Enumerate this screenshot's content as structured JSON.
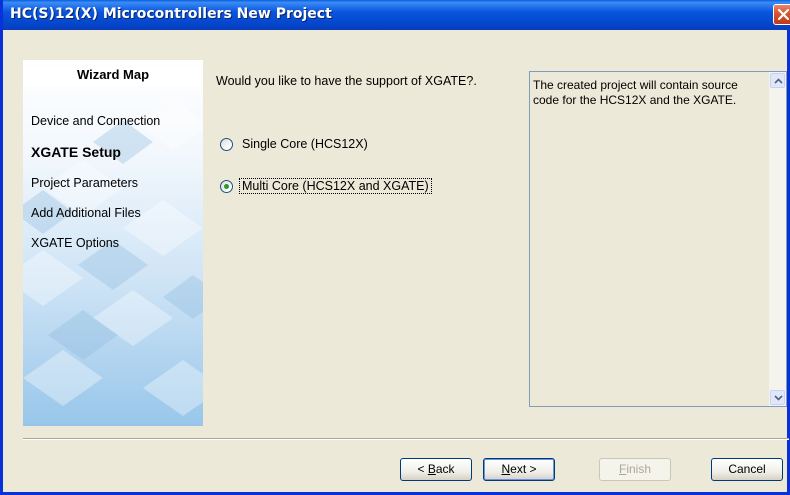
{
  "window": {
    "title": "HC(S)12(X) Microcontrollers New Project"
  },
  "wizard_map": {
    "title": "Wizard Map",
    "steps": [
      {
        "label": "Device and Connection",
        "active": false
      },
      {
        "label": "XGATE Setup",
        "active": true
      },
      {
        "label": "Project Parameters",
        "active": false
      },
      {
        "label": "Add Additional Files",
        "active": false
      },
      {
        "label": "XGATE Options",
        "active": false
      }
    ]
  },
  "main": {
    "question": "Would you like to have the support of XGATE?.",
    "options": [
      {
        "label": "Single Core (HCS12X)",
        "selected": false
      },
      {
        "label": "Multi Core (HCS12X and XGATE)",
        "selected": true
      }
    ],
    "description": "The created project will contain source code for the HCS12X and the XGATE."
  },
  "buttons": {
    "back_prefix": "< ",
    "back_mnemonic": "B",
    "back_rest": "ack",
    "next_mnemonic": "N",
    "next_rest": "ext >",
    "finish_mnemonic": "F",
    "finish_rest": "inish",
    "cancel": "Cancel"
  },
  "colors": {
    "title_bar": "#0855dd",
    "dialog_bg": "#ece9d8",
    "close_button": "#d9532f",
    "radio_checked": "#2a9a2a"
  },
  "icons": {
    "close": "close-x-icon",
    "scroll_up": "scroll-up-arrow-icon",
    "scroll_down": "scroll-down-arrow-icon"
  }
}
